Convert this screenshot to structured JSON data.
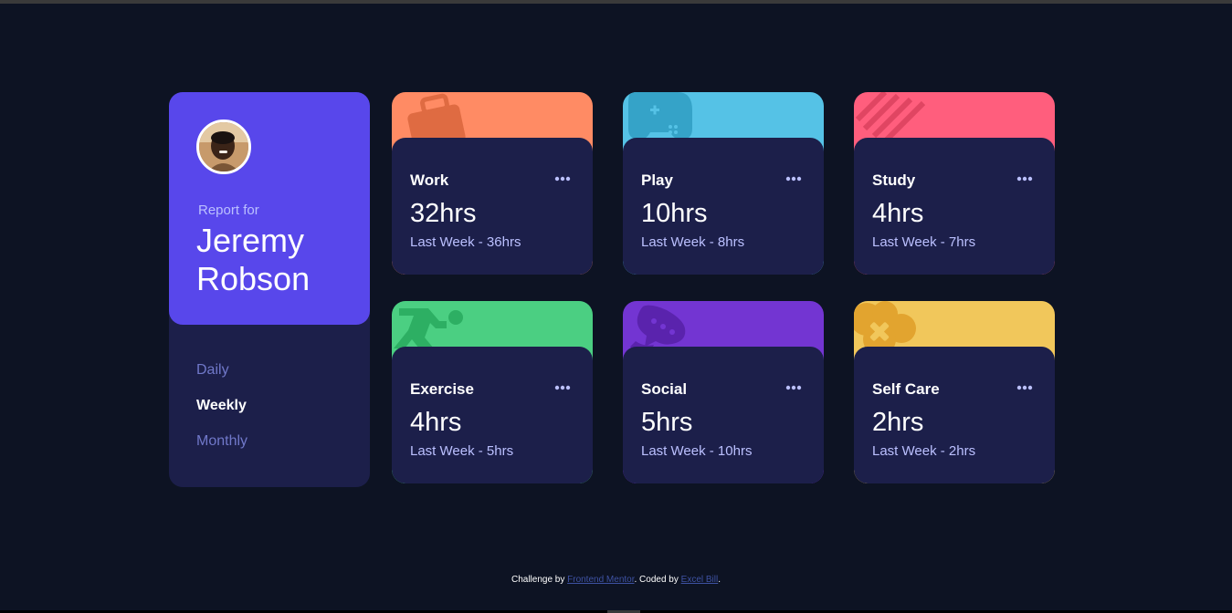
{
  "profile": {
    "report_label": "Report for",
    "name": "Jeremy Robson",
    "periods": [
      "Daily",
      "Weekly",
      "Monthly"
    ],
    "active_period": "Weekly"
  },
  "cards": [
    {
      "title": "Work",
      "current": "32hrs",
      "previous": "Last Week - 36hrs",
      "color": "#ff8b64",
      "icon": "briefcase-icon"
    },
    {
      "title": "Play",
      "current": "10hrs",
      "previous": "Last Week - 8hrs",
      "color": "#55c2e6",
      "icon": "gamepad-icon"
    },
    {
      "title": "Study",
      "current": "4hrs",
      "previous": "Last Week - 7hrs",
      "color": "#ff5e7d",
      "icon": "book-icon"
    },
    {
      "title": "Exercise",
      "current": "4hrs",
      "previous": "Last Week - 5hrs",
      "color": "#4bcf82",
      "icon": "running-icon"
    },
    {
      "title": "Social",
      "current": "5hrs",
      "previous": "Last Week - 10hrs",
      "color": "#7335d2",
      "icon": "chat-icon"
    },
    {
      "title": "Self Care",
      "current": "2hrs",
      "previous": "Last Week - 2hrs",
      "color": "#f1c75b",
      "icon": "self-care-icon"
    }
  ],
  "footer": {
    "prefix": "Challenge by ",
    "link1": "Frontend Mentor",
    "middle": ". Coded by ",
    "link2": "Excel Bill",
    "suffix": "."
  },
  "colors": {
    "background": "#0d1323",
    "card": "#1c1f4a",
    "accent": "#5847eb",
    "muted": "#bbc0ff"
  }
}
